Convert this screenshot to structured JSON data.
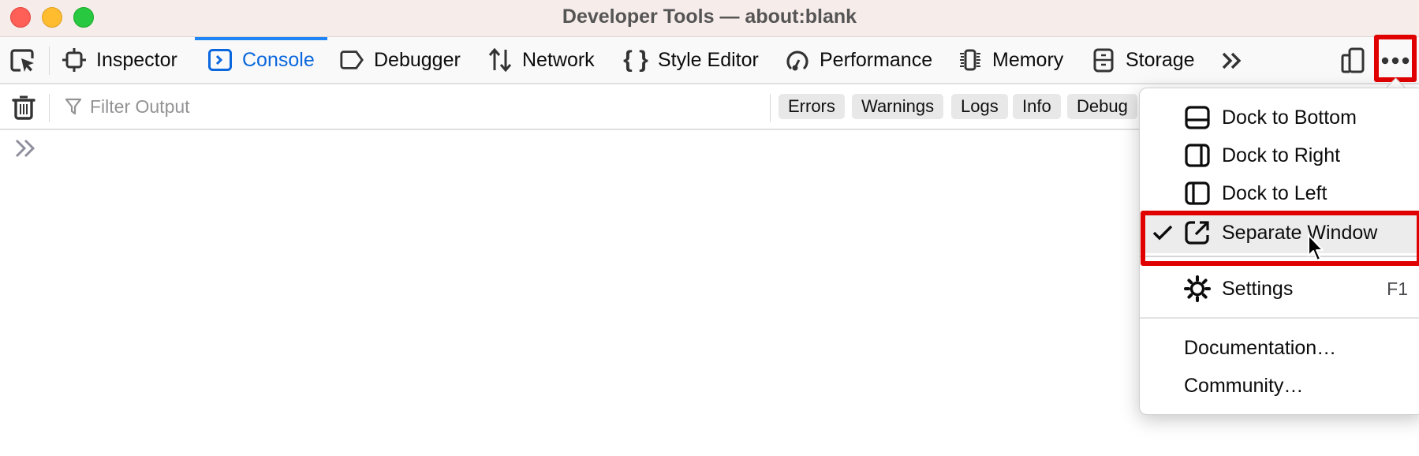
{
  "window": {
    "title": "Developer Tools — about:blank",
    "traffic_lights": [
      "close",
      "minimize",
      "maximize"
    ]
  },
  "toolbar": {
    "picker_icon": "element-picker-icon",
    "tabs": [
      {
        "label": "Inspector",
        "icon": "inspector-icon",
        "active": false
      },
      {
        "label": "Console",
        "icon": "console-icon",
        "active": true
      },
      {
        "label": "Debugger",
        "icon": "debugger-icon",
        "active": false
      },
      {
        "label": "Network",
        "icon": "network-icon",
        "active": false
      },
      {
        "label": "Style Editor",
        "icon": "style-editor-icon",
        "active": false
      },
      {
        "label": "Performance",
        "icon": "performance-icon",
        "active": false
      },
      {
        "label": "Memory",
        "icon": "memory-icon",
        "active": false
      },
      {
        "label": "Storage",
        "icon": "storage-icon",
        "active": false
      }
    ],
    "overflow_icon": "chevrons-right-icon",
    "responsive_design_icon": "responsive-design-icon",
    "more_options_icon": "more-options-icon",
    "accent_color": "#0a67dd"
  },
  "filterbar": {
    "clear_icon": "trash-icon",
    "filter_placeholder": "Filter Output",
    "filter_value": "",
    "chips": [
      "Errors",
      "Warnings",
      "Logs",
      "Info",
      "Debug"
    ]
  },
  "console": {
    "prompt_icon": "console-prompt-icon"
  },
  "menu": {
    "items": [
      {
        "label": "Dock to Bottom",
        "icon": "dock-bottom-icon",
        "checked": false
      },
      {
        "label": "Dock to Right",
        "icon": "dock-right-icon",
        "checked": false
      },
      {
        "label": "Dock to Left",
        "icon": "dock-left-icon",
        "checked": false
      },
      {
        "label": "Separate Window",
        "icon": "separate-window-icon",
        "checked": true
      }
    ],
    "settings": {
      "label": "Settings",
      "icon": "gear-icon",
      "shortcut": "F1"
    },
    "links": [
      {
        "label": "Documentation…"
      },
      {
        "label": "Community…"
      }
    ]
  },
  "highlight_color": "#e10000"
}
